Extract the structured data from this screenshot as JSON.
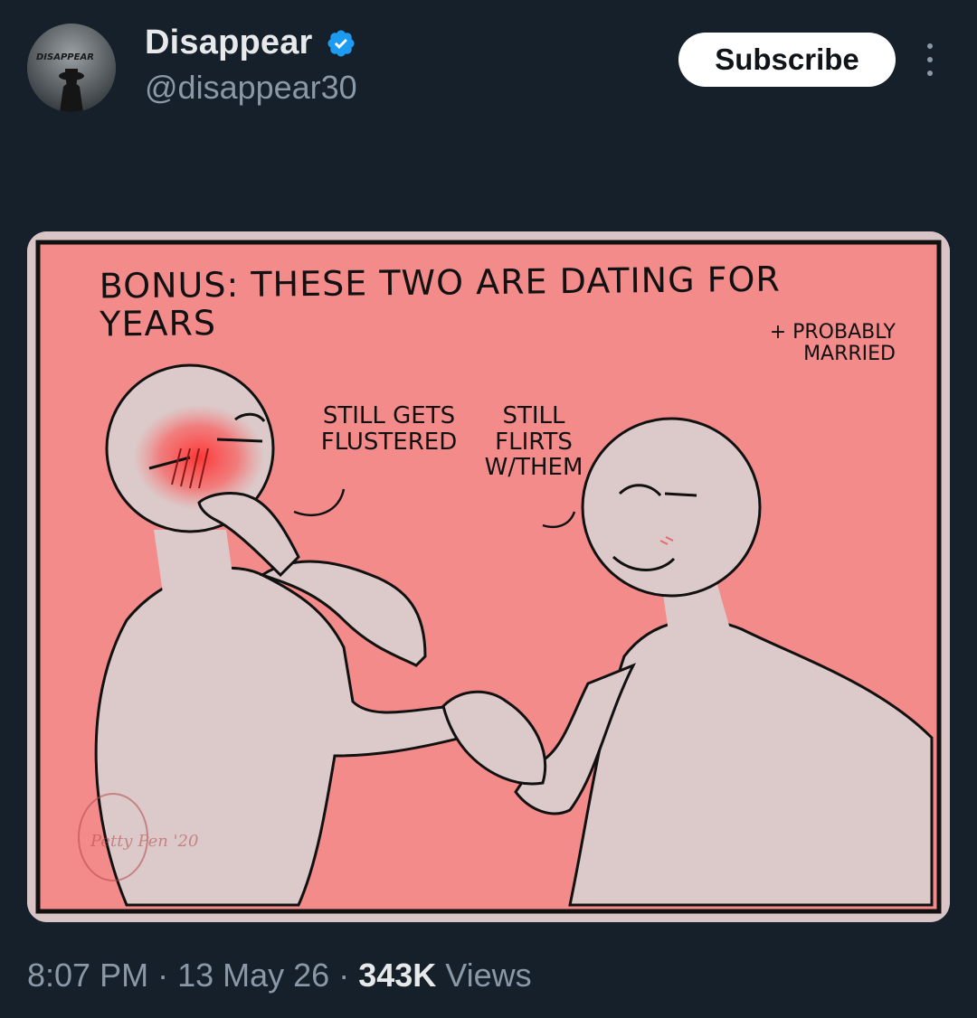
{
  "author": {
    "display_name": "Disappear",
    "handle": "@disappear30",
    "avatar_text": "DISAPPEAR",
    "verified_icon": "verified-badge-icon"
  },
  "actions": {
    "subscribe_label": "Subscribe",
    "more_icon": "more-vertical-icon"
  },
  "media": {
    "title": "Bonus: These two are dating for years",
    "note": "+ Probably\nMarried",
    "caption_left": "Still gets\nflustered",
    "caption_right": "Still\nflirts\nw/them",
    "signature": "Petty Pen '20",
    "colors": {
      "background": "#f48b8b",
      "skin": "#dcc9c9",
      "frame": "#d9c5c5",
      "blush": "#ff3b3b"
    }
  },
  "meta": {
    "time": "8:07 PM",
    "separator": "·",
    "date": "13 May 26",
    "views_count": "343K",
    "views_label": "Views"
  }
}
